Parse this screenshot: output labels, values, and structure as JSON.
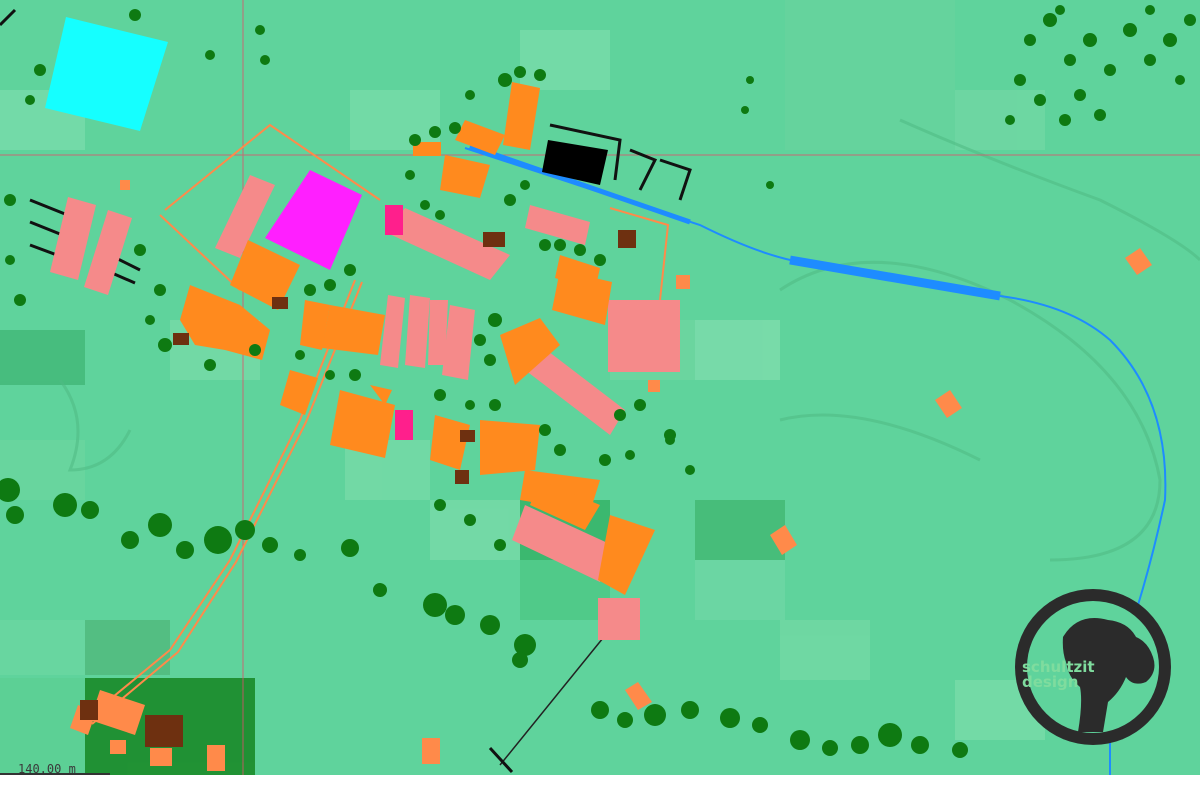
{
  "map": {
    "scale_label": "140.00 m"
  },
  "logo": {
    "line1": "schultzit",
    "line2": "design",
    "icon": "dog-head-icon",
    "ring_color": "#2b2b2b",
    "text_color": "#7fdc9e"
  },
  "colors": {
    "terrain": "#5fd39c",
    "terrain_dark": "#4fbf87",
    "terrain_light": "#7fe0b0",
    "trees": "#0e7a12",
    "building_orange": "#ff8a1e",
    "building_pink": "#f58a8a",
    "building_brown": "#6e3010",
    "building_magenta": "#ff1fff",
    "helipad_cyan": "#15ffff",
    "water": "#1e8cff",
    "grid_line": "#e0506a"
  }
}
